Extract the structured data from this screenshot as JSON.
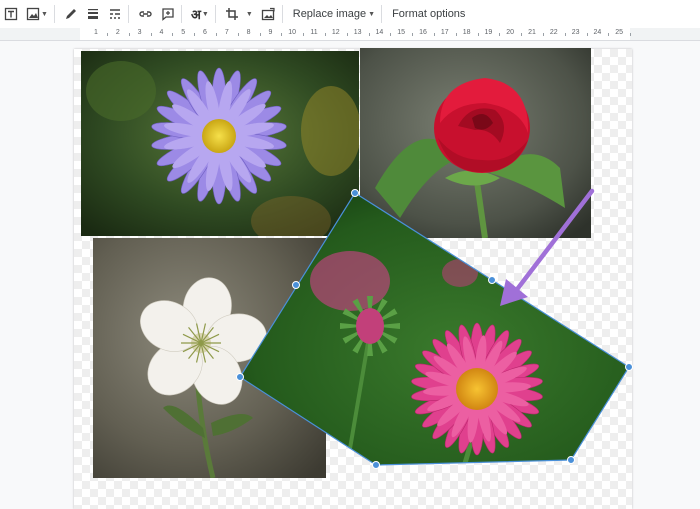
{
  "toolbar": {
    "replace_image_label": "Replace image",
    "format_options_label": "Format options",
    "input_tool_glyph": "अ"
  },
  "ruler": {
    "numbers": [
      "1",
      "2",
      "3",
      "4",
      "5",
      "6",
      "7",
      "8",
      "9",
      "10",
      "11",
      "12",
      "13",
      "14",
      "15",
      "16",
      "17",
      "18",
      "19",
      "20",
      "21",
      "22",
      "23",
      "24",
      "25"
    ]
  },
  "images": [
    {
      "name": "purple-daisy-photo",
      "subject": "purple aster flower"
    },
    {
      "name": "red-rose-photo",
      "subject": "red rose"
    },
    {
      "name": "white-flower-photo",
      "subject": "white flower"
    },
    {
      "name": "pink-daisy-photo",
      "subject": "pink daisy (rotated, selected)"
    }
  ],
  "colors": {
    "selection": "#4a90d9",
    "arrow": "#a070d8"
  }
}
